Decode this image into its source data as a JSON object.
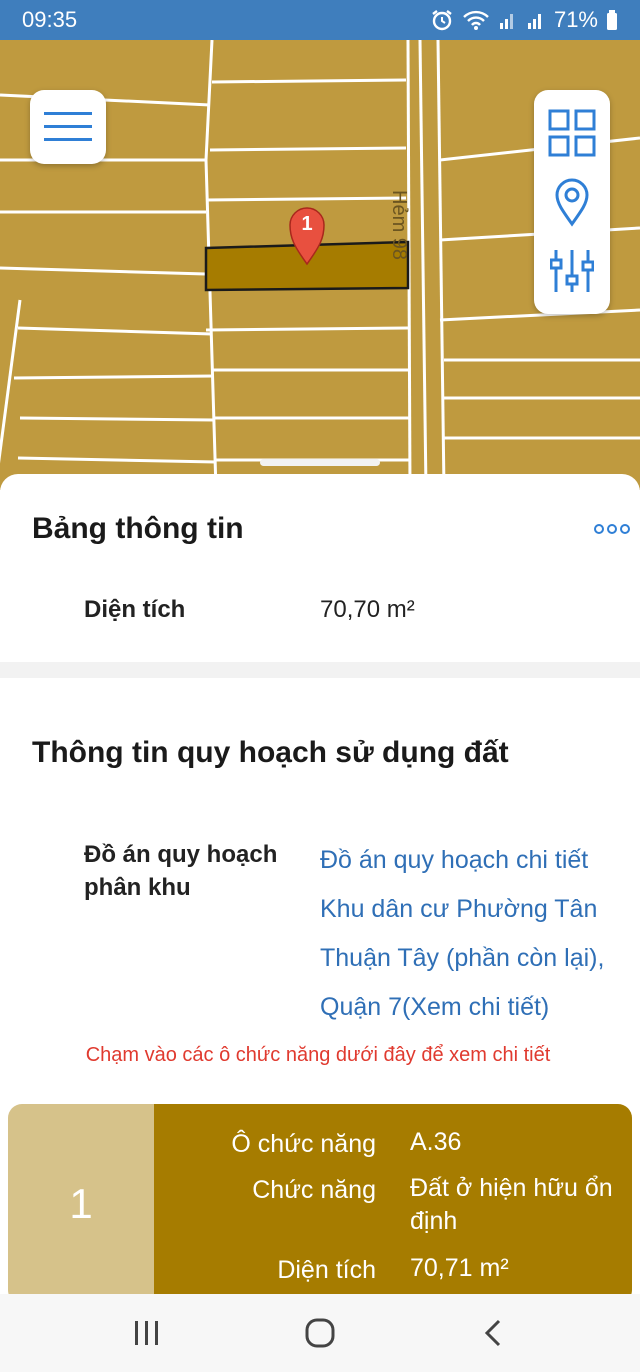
{
  "status_bar": {
    "time": "09:35",
    "battery": "71%"
  },
  "map": {
    "road_label": "Hẻm 98",
    "marker_label": "1",
    "colors": {
      "land": "#bf9a3f",
      "parcel": "#a67c00",
      "marker": "#e8503f"
    }
  },
  "info_panel": {
    "title": "Bảng thông tin",
    "area_label": "Diện tích",
    "area_value": "70,70 m²"
  },
  "planning": {
    "title": "Thông tin quy hoạch sử dụng đất",
    "plan_label": "Đồ án quy hoạch phân khu",
    "plan_link": "Đồ án quy hoạch chi tiết Khu dân cư Phường Tân Thuận Tây (phần còn lại), Quận 7(Xem chi tiết)",
    "hint": "Chạm vào các ô chức năng dưới đây để xem chi tiết"
  },
  "function_card": {
    "number": "1",
    "rows": [
      {
        "label": "Ô chức năng",
        "value": "A.36"
      },
      {
        "label": "Chức năng",
        "value": "Đất ở hiện hữu ổn định"
      },
      {
        "label": "Diện tích",
        "value": "70,71 m²"
      }
    ]
  },
  "icons": {
    "menu": "hamburger-icon",
    "grid": "grid-icon",
    "location": "location-pin-icon",
    "filter": "sliders-icon",
    "more": "more-horizontal-icon"
  }
}
